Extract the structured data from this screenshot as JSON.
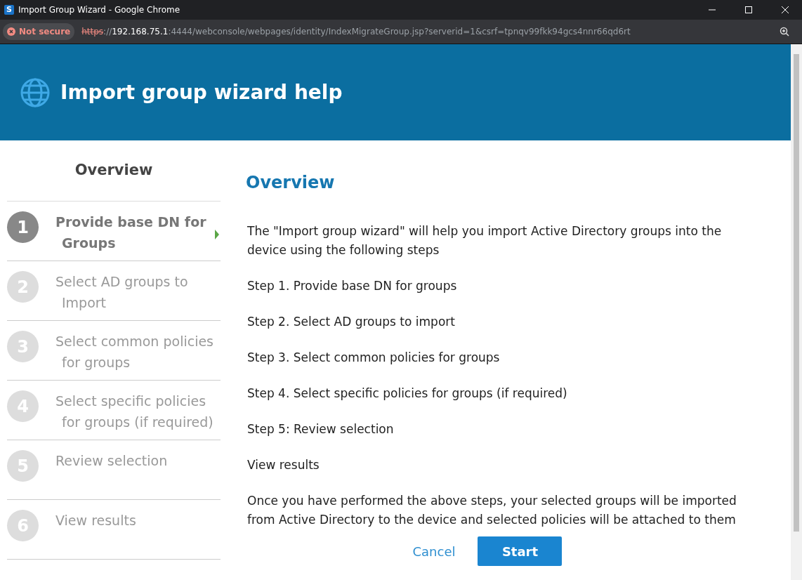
{
  "window": {
    "title": "Import Group Wizard - Google Chrome",
    "app_icon": "S"
  },
  "address_bar": {
    "security": "Not secure",
    "url_scheme": "https",
    "url_separator": "://",
    "url_host": "192.168.75.1",
    "url_rest": ":4444/webconsole/webpages/identity/IndexMigrateGroup.jsp?serverid=1&csrf=tpnqv99fkk94gcs4nnr66qd6rt"
  },
  "header": {
    "title": "Import group wizard help"
  },
  "sidebar": {
    "title": "Overview",
    "steps": [
      {
        "number": "1",
        "lines": [
          "Provide base DN for",
          "Groups"
        ],
        "selected": true
      },
      {
        "number": "2",
        "lines": [
          "Select AD groups to",
          "Import"
        ],
        "selected": false
      },
      {
        "number": "3",
        "lines": [
          "Select common policies",
          "for groups"
        ],
        "selected": false
      },
      {
        "number": "4",
        "lines": [
          "Select specific policies",
          "for groups (if required)"
        ],
        "selected": false
      },
      {
        "number": "5",
        "lines": [
          "Review selection"
        ],
        "selected": false
      },
      {
        "number": "6",
        "lines": [
          "View results"
        ],
        "selected": false
      }
    ]
  },
  "content": {
    "title": "Overview",
    "paragraphs": [
      "The \"Import group wizard\" will help you import Active Directory groups into the device using the following steps",
      "Step 1. Provide base DN for groups",
      "Step 2. Select AD groups to import",
      "Step 3. Select common policies for groups",
      "Step 4. Select specific policies for groups (if required)",
      "Step 5: Review selection",
      "View results",
      "Once you have performed the above steps, your selected groups will be imported from Active Directory to the device and selected policies will be attached to them"
    ]
  },
  "buttons": {
    "cancel": "Cancel",
    "start": "Start"
  }
}
